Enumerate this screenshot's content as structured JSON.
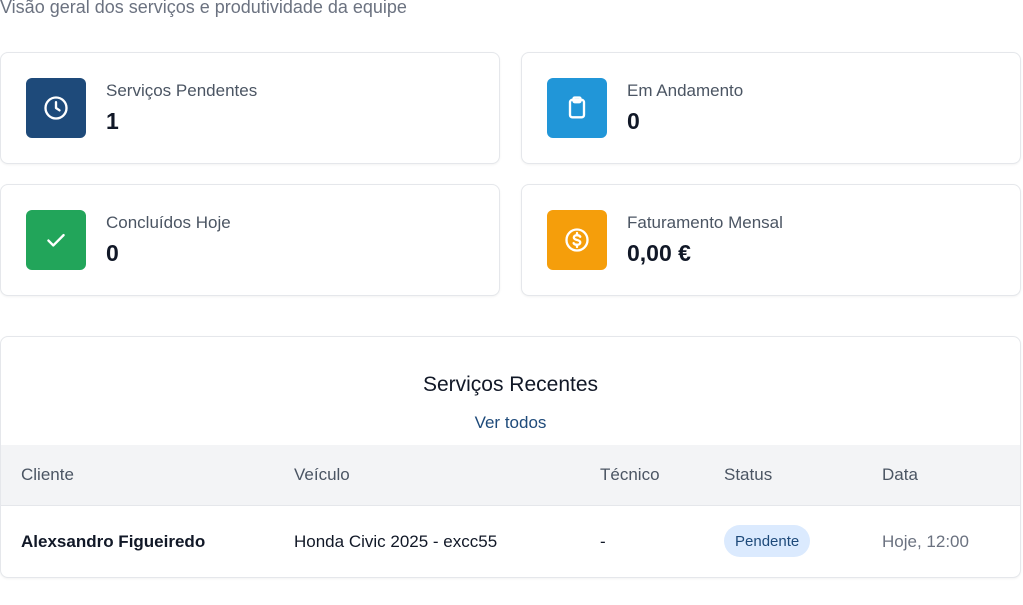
{
  "header": {
    "subtitle": "Visão geral dos serviços e produtividade da equipe"
  },
  "stats": [
    {
      "label": "Serviços Pendentes",
      "value": "1",
      "icon": "clock-icon",
      "color": "#1e4a7a"
    },
    {
      "label": "Em Andamento",
      "value": "0",
      "icon": "clipboard-icon",
      "color": "#2196d8"
    },
    {
      "label": "Concluídos Hoje",
      "value": "0",
      "icon": "check-icon",
      "color": "#22a55a"
    },
    {
      "label": "Faturamento Mensal",
      "value": "0,00 €",
      "icon": "dollar-icon",
      "color": "#f59e0b"
    }
  ],
  "recent": {
    "title": "Serviços Recentes",
    "see_all": "Ver todos",
    "columns": [
      "Cliente",
      "Veículo",
      "Técnico",
      "Status",
      "Data"
    ],
    "rows": [
      {
        "client": "Alexsandro Figueiredo",
        "vehicle": "Honda Civic 2025 - excc55",
        "technician": "-",
        "status": "Pendente",
        "date": "Hoje, 12:00"
      }
    ]
  }
}
